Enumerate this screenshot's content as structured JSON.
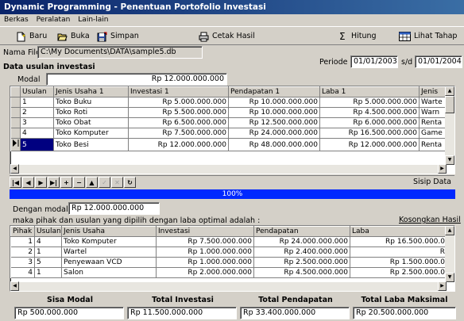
{
  "window": {
    "title": "Dynamic Programming - Penentuan Portofolio Investasi"
  },
  "menu": [
    "Berkas",
    "Peralatan",
    "Lain-lain"
  ],
  "toolbar": {
    "baru": "Baru",
    "buka": "Buka",
    "simpan": "Simpan",
    "cetak": "Cetak Hasil",
    "hitung": "Hitung",
    "lihat": "Lihat Tahap"
  },
  "file": {
    "label": "Nama File",
    "value": "C:\\My Documents\\DATA\\sample5.db"
  },
  "section1": {
    "title": "Data usulan investasi"
  },
  "periode": {
    "label": "Periode",
    "from": "01/01/2003",
    "sep": "s/d",
    "to": "01/01/2004"
  },
  "modal": {
    "label": "Modal",
    "value": "Rp 12.000.000.000"
  },
  "grid1": {
    "headers": [
      "Usulan",
      "Jenis Usaha 1",
      "Investasi 1",
      "Pendapatan 1",
      "Laba 1",
      "Jenis"
    ],
    "rows": [
      [
        "1",
        "Toko Buku",
        "Rp 5.000.000.000",
        "Rp 10.000.000.000",
        "Rp 5.000.000.000",
        "Warte"
      ],
      [
        "2",
        "Toko Roti",
        "Rp 5.500.000.000",
        "Rp 10.000.000.000",
        "Rp 4.500.000.000",
        "Warn"
      ],
      [
        "3",
        "Toko Obat",
        "Rp 6.500.000.000",
        "Rp 12.500.000.000",
        "Rp 6.000.000.000",
        "Renta"
      ],
      [
        "4",
        "Toko Komputer",
        "Rp 7.500.000.000",
        "Rp 24.000.000.000",
        "Rp 16.500.000.000",
        "Game"
      ],
      [
        "5",
        "Toko Besi",
        "Rp 12.000.000.000",
        "Rp 48.000.000.000",
        "Rp 12.000.000.000",
        "Renta"
      ]
    ]
  },
  "nav": {
    "sisip": "Sisip Data"
  },
  "progress": {
    "value": 100,
    "label": "100%"
  },
  "dengan_modal": {
    "label": "Dengan modal",
    "value": "Rp 12.000.000.000"
  },
  "result_caption": "maka pihak dan usulan yang dipilih dengan laba optimal adalah :",
  "kosongkan": "Kosongkan Hasil",
  "grid2": {
    "headers": [
      "Pihak",
      "Usulan",
      "Jenis Usaha",
      "Investasi",
      "Pendapatan",
      "Laba"
    ],
    "rows": [
      [
        "1",
        "4",
        "Toko Komputer",
        "Rp 7.500.000.000",
        "Rp 24.000.000.000",
        "Rp 16.500.000.0"
      ],
      [
        "2",
        "1",
        "Wartel",
        "Rp 1.000.000.000",
        "Rp 2.400.000.000",
        "R"
      ],
      [
        "3",
        "5",
        "Penyewaan VCD",
        "Rp 1.000.000.000",
        "Rp 2.500.000.000",
        "Rp 1.500.000.0"
      ],
      [
        "4",
        "1",
        "Salon",
        "Rp 2.000.000.000",
        "Rp 4.500.000.000",
        "Rp 2.500.000.0"
      ]
    ]
  },
  "summary": {
    "sisa_label": "Sisa Modal",
    "sisa": "Rp 500.000.000",
    "inv_label": "Total Investasi",
    "inv": "Rp 11.500.000.000",
    "pend_label": "Total Pendapatan",
    "pend": "Rp 33.400.000.000",
    "laba_label": "Total Laba Maksimal",
    "laba": "Rp 20.500.000.000"
  },
  "colors": {
    "title_start": "#0a246a",
    "title_end": "#3a6ea5",
    "progress": "#0028ff",
    "face": "#d4d0c8"
  }
}
